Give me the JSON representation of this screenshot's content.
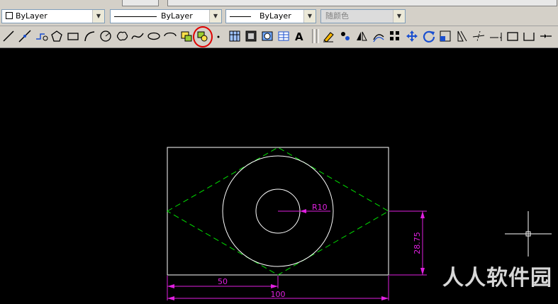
{
  "properties_bar": {
    "color": {
      "value": "ByLayer"
    },
    "linetype": {
      "value": "ByLayer"
    },
    "lineweight": {
      "value": "ByLayer"
    },
    "plotstyle": {
      "value": "随颜色"
    }
  },
  "draw_toolbar": [
    {
      "name": "line-icon"
    },
    {
      "name": "construction-line-icon"
    },
    {
      "name": "polyline-icon"
    },
    {
      "name": "polygon-icon"
    },
    {
      "name": "rectangle-icon"
    },
    {
      "name": "arc-icon"
    },
    {
      "name": "circle-icon"
    },
    {
      "name": "revision-cloud-icon"
    },
    {
      "name": "spline-icon"
    },
    {
      "name": "ellipse-icon"
    },
    {
      "name": "ellipse-arc-icon"
    },
    {
      "name": "insert-block-icon"
    },
    {
      "name": "make-block-icon"
    },
    {
      "name": "point-icon"
    },
    {
      "name": "hatch-icon"
    },
    {
      "name": "gradient-icon"
    },
    {
      "name": "region-icon"
    },
    {
      "name": "table-icon"
    },
    {
      "name": "multiline-text-icon"
    }
  ],
  "modify_toolbar": [
    {
      "name": "erase-icon"
    },
    {
      "name": "copy-icon"
    },
    {
      "name": "mirror-icon"
    },
    {
      "name": "offset-icon"
    },
    {
      "name": "array-icon"
    },
    {
      "name": "move-icon"
    },
    {
      "name": "rotate-icon"
    },
    {
      "name": "scale-icon"
    },
    {
      "name": "stretch-icon"
    },
    {
      "name": "trim-icon"
    },
    {
      "name": "extend-icon"
    },
    {
      "name": "break-icon"
    },
    {
      "name": "join-icon"
    },
    {
      "name": "chamfer-icon"
    }
  ],
  "drawing": {
    "radius_label": "R10",
    "width_total_label": "100",
    "width_half_label": "50",
    "height_label": "28.75"
  },
  "colors": {
    "geometry": "#ffffff",
    "construction": "#00e000",
    "dimension": "#e020e0",
    "annotation": "#e00000",
    "background": "#000000"
  },
  "watermark": "人人软件园"
}
